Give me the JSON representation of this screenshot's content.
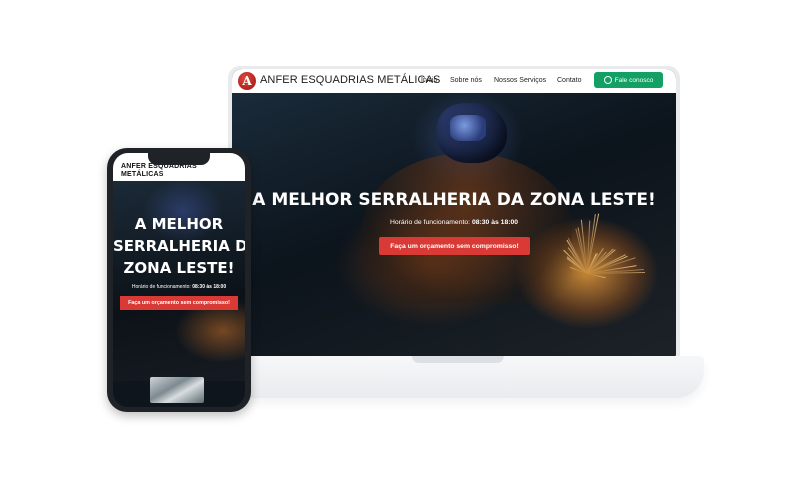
{
  "desktop": {
    "brand": "ANFER ESQUADRIAS METÁLICAS",
    "logo_letter": "A",
    "nav": [
      "Inicio",
      "Sobre nós",
      "Nossos Serviços",
      "Contato"
    ],
    "cta_nav": "Fale conosco",
    "hero_title": "A MELHOR SERRALHERIA DA ZONA LESTE!",
    "hours_label": "Horário de funcionamento: ",
    "hours_value": "08:30 às 18:00",
    "hero_cta": "Faça um orçamento sem compromisso!"
  },
  "mobile": {
    "brand_line1": "ANFER ESQUADRIAS",
    "brand_line2": "METÁLICAS",
    "title_line1": "A MELHOR",
    "title_line2": "SERRALHERIA DA",
    "title_line3": "ZONA LESTE!",
    "hours_label": "Horário de funcionamento: ",
    "hours_value": "08:30 às 18:00",
    "cta": "Faça um orçamento sem compromisso!"
  },
  "colors": {
    "accent_red": "#d93a36",
    "whatsapp_green": "#13a064",
    "logo_red": "#9b1410"
  }
}
